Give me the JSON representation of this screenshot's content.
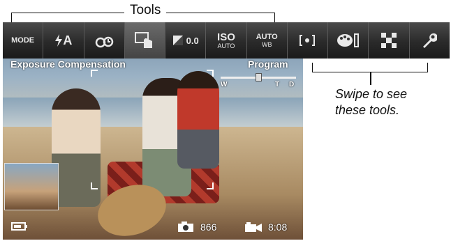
{
  "annotations": {
    "tools_label": "Tools",
    "swipe_caption_line1": "Swipe to see",
    "swipe_caption_line2": "these tools."
  },
  "toolbar": {
    "items": [
      {
        "label": "MODE",
        "icon": "mode-icon"
      },
      {
        "label": "A",
        "icon": "flash-auto-icon"
      },
      {
        "label": "",
        "icon": "self-timer-icon"
      },
      {
        "label": "",
        "icon": "touch-shutter-icon"
      },
      {
        "label": "0.0",
        "icon": "exposure-compensation-icon"
      },
      {
        "label": "ISO",
        "sub": "AUTO",
        "icon": "iso-icon"
      },
      {
        "label": "AUTO",
        "sub": "WB",
        "icon": "white-balance-icon"
      },
      {
        "label": "",
        "icon": "focus-mode-icon"
      },
      {
        "label": "",
        "icon": "color-mode-icon"
      },
      {
        "label": "",
        "icon": "picture-size-icon"
      },
      {
        "label": "",
        "icon": "setup-wrench-icon"
      }
    ]
  },
  "overlay": {
    "exposure_label": "Exposure Compensation",
    "program_label": "Program",
    "zoom_w": "W",
    "zoom_t": "T",
    "zoom_d": "D",
    "pictures_remaining": "866",
    "video_time": "8:08"
  },
  "colors": {
    "toolbar_bg": "#2a2a2a",
    "overlay_text": "#ffffff",
    "annotation_text": "#111111"
  }
}
